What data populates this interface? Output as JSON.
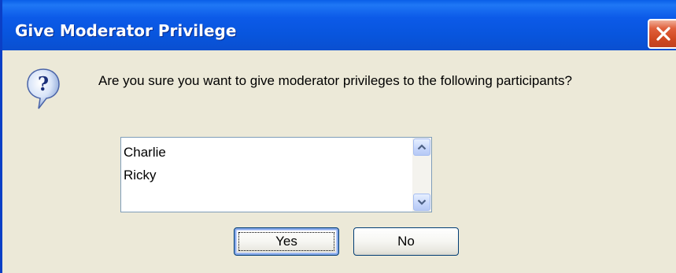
{
  "window": {
    "title": "Give Moderator Privilege",
    "close_icon": "close-icon"
  },
  "dialog": {
    "icon": "question-icon",
    "message": "Are you sure you want to give moderator privileges to the following participants?",
    "participants": [
      "Charlie",
      "Ricky"
    ],
    "scroll_up_icon": "chevron-up-icon",
    "scroll_down_icon": "chevron-down-icon"
  },
  "buttons": {
    "yes_label": "Yes",
    "no_label": "No"
  },
  "colors": {
    "titlebar": "#0855dd",
    "dialog_background": "#ece9d8",
    "close_button": "#d04820",
    "button_border": "#003c74"
  }
}
